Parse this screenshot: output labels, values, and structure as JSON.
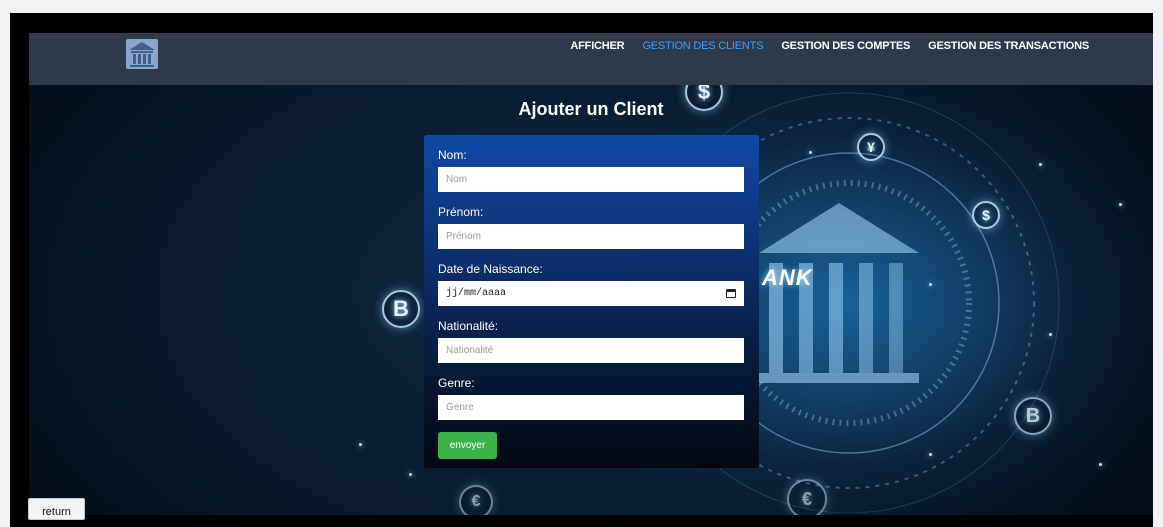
{
  "navbar": {
    "logo_icon": "bank-building-icon",
    "links": [
      {
        "label": "AFFICHER",
        "active": false
      },
      {
        "label": "GESTION DES CLIENTS",
        "active": true
      },
      {
        "label": "GESTION DES COMPTES",
        "active": false
      },
      {
        "label": "GESTION DES TRANSACTIONS",
        "active": false
      }
    ]
  },
  "page": {
    "title": "Ajouter un Client",
    "background_text": "ANK"
  },
  "form": {
    "fields": [
      {
        "label": "Nom:",
        "placeholder": "Nom"
      },
      {
        "label": "Prénom:",
        "placeholder": "Prénom"
      },
      {
        "label": "Date de Naissance:",
        "value": "jj/mm/aaaa"
      },
      {
        "label": "Nationalité:",
        "placeholder": "Nationalité"
      },
      {
        "label": "Genre:",
        "placeholder": "Genre"
      }
    ],
    "submit_label": "envoyer"
  },
  "return_label": "return",
  "colors": {
    "navbar": "#2e3a49",
    "active_link": "#3aa0ff",
    "form_top": "#1148a6",
    "submit": "#3bb24a"
  }
}
